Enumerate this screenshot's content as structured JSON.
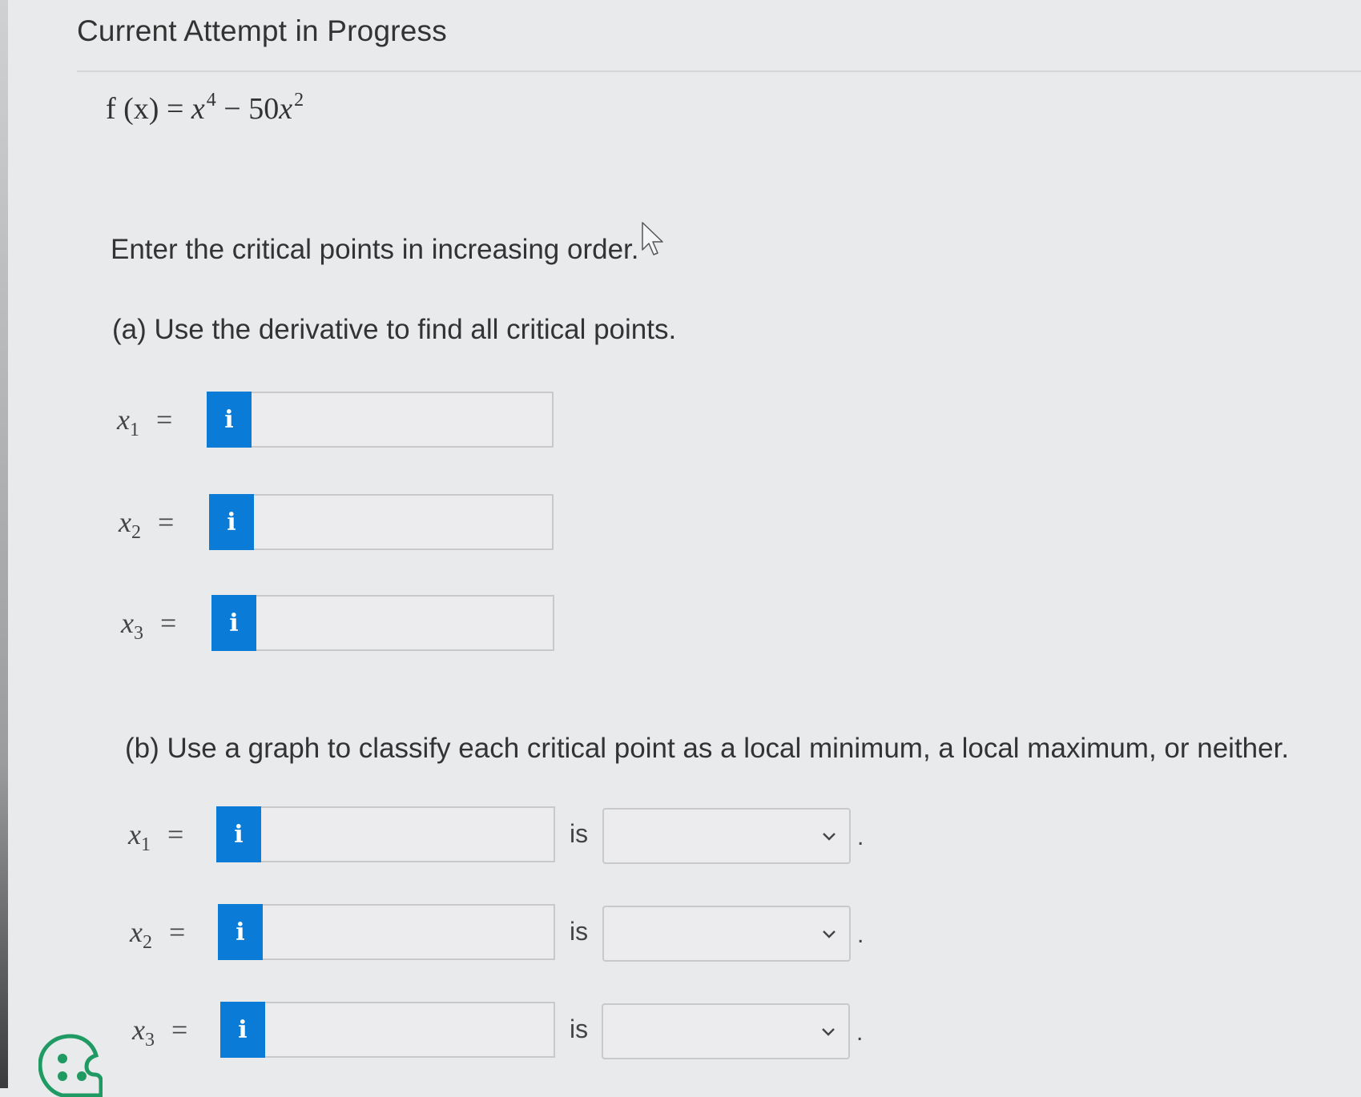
{
  "header": {
    "title": "Current Attempt in Progress"
  },
  "problem": {
    "function_lhs": "f (x) = ",
    "function_x": "x",
    "function_exp1": "4",
    "function_mid": " − 50",
    "function_x2": "x",
    "function_exp2": "2",
    "instruction": "Enter the critical points in increasing order."
  },
  "part_a": {
    "heading": "(a) Use the derivative to find all critical points.",
    "rows": [
      {
        "var": "x",
        "sub": "1",
        "eq": "=",
        "info": "i",
        "value": ""
      },
      {
        "var": "x",
        "sub": "2",
        "eq": "=",
        "info": "i",
        "value": ""
      },
      {
        "var": "x",
        "sub": "3",
        "eq": "=",
        "info": "i",
        "value": ""
      }
    ]
  },
  "part_b": {
    "heading": "(b) Use a graph to classify each critical point as a local minimum, a local maximum, or neither.",
    "rows": [
      {
        "var": "x",
        "sub": "1",
        "eq": "=",
        "info": "i",
        "value": "",
        "is": "is",
        "classification": "",
        "period": "."
      },
      {
        "var": "x",
        "sub": "2",
        "eq": "=",
        "info": "i",
        "value": "",
        "is": "is",
        "classification": "",
        "period": "."
      },
      {
        "var": "x",
        "sub": "3",
        "eq": "=",
        "info": "i",
        "value": "",
        "is": "is",
        "classification": "",
        "period": "."
      }
    ]
  },
  "icons": {
    "info": "info-icon",
    "dropdown": "chevron-down-icon",
    "cursor": "mouse-pointer-icon",
    "widget": "palette-icon"
  },
  "colors": {
    "accent": "#0a7bd6",
    "background": "#e8eaec",
    "input_border": "#c7c9cb"
  }
}
